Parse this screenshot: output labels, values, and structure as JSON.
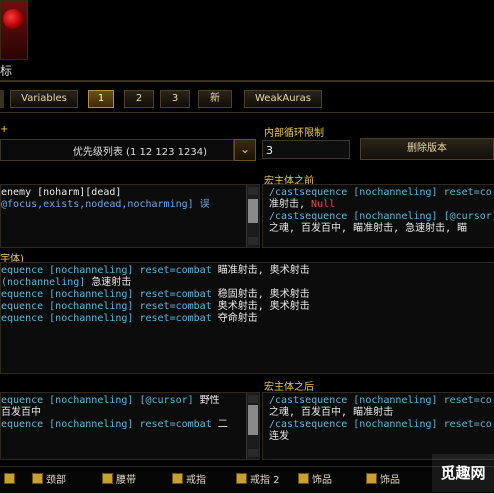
{
  "header": {
    "icon_label": "标"
  },
  "tabs": [
    "Variables",
    "1",
    "2",
    "3",
    "新",
    "WeakAuras"
  ],
  "active_tab": "1",
  "left_section_label": "",
  "priority_dropdown": {
    "value": "优先级列表 (1 12 123 1234)"
  },
  "inner_loop_label": "内部循环限制",
  "inner_loop_value": "3",
  "delete_button": "删除版本",
  "pre_macro_label": "宏主体之前",
  "top_left_lines": [
    {
      "parts": [
        {
          "t": "enemy [noharm][dead]",
          "c": "white"
        }
      ]
    },
    {
      "parts": [
        {
          "t": "@focus,exists,nodead,nocharming] 误",
          "c": "blue"
        }
      ]
    }
  ],
  "top_right_lines": [
    {
      "parts": [
        {
          "t": "/castsequence [nochanneling] reset=co",
          "c": "cyan"
        }
      ]
    },
    {
      "parts": [
        {
          "t": "准射击, ",
          "c": "white"
        },
        {
          "t": "Null",
          "c": "red"
        }
      ]
    },
    {
      "parts": [
        {
          "t": "/castsequence [nochanneling] [@cursor]",
          "c": "cyan"
        }
      ]
    },
    {
      "parts": [
        {
          "t": "之魂, 百发百中, 瞄准射击, 急速射击, 瞄",
          "c": "white"
        }
      ]
    }
  ],
  "body_label": "宇体)",
  "body_lines": [
    {
      "parts": [
        {
          "t": "equence [nochanneling] reset=combat ",
          "c": "cyan"
        },
        {
          "t": "瞄准射击, 奥术射击",
          "c": "white"
        }
      ]
    },
    {
      "parts": [
        {
          "t": "(nochanneling] ",
          "c": "cyan"
        },
        {
          "t": "急速射击",
          "c": "white"
        }
      ]
    },
    {
      "parts": [
        {
          "t": "equence [nochanneling] reset=combat ",
          "c": "cyan"
        },
        {
          "t": "稳固射击, 奥术射击",
          "c": "white"
        }
      ]
    },
    {
      "parts": [
        {
          "t": "equence [nochanneling] reset=combat ",
          "c": "cyan"
        },
        {
          "t": "奥术射击, 奥术射击",
          "c": "white"
        }
      ]
    },
    {
      "parts": [
        {
          "t": "equence [nochanneling] reset=combat ",
          "c": "cyan"
        },
        {
          "t": "夺命射击",
          "c": "white"
        }
      ]
    }
  ],
  "post_macro_label": "宏主体之后",
  "bottom_left_lines": [
    {
      "parts": [
        {
          "t": "equence [nochanneling] [@cursor] ",
          "c": "cyan"
        },
        {
          "t": "野性",
          "c": "white"
        }
      ]
    },
    {
      "parts": [
        {
          "t": "百发百中",
          "c": "white"
        }
      ]
    },
    {
      "parts": [
        {
          "t": "equence [nochanneling] reset=combat ",
          "c": "cyan"
        },
        {
          "t": "二",
          "c": "white"
        }
      ]
    }
  ],
  "bottom_right_lines": [
    {
      "parts": [
        {
          "t": "/castsequence [nochanneling] reset=co",
          "c": "cyan"
        }
      ]
    },
    {
      "parts": [
        {
          "t": "之魂, 百发百中, 瞄准射击",
          "c": "white"
        }
      ]
    },
    {
      "parts": [
        {
          "t": "/castsequence [nochanneling] reset=co",
          "c": "cyan"
        }
      ]
    },
    {
      "parts": [
        {
          "t": "连发",
          "c": "white"
        }
      ]
    }
  ],
  "bottom_slots": [
    "颈部",
    "腰带",
    "戒指",
    "戒指 2",
    "饰品",
    "饰品"
  ],
  "watermark": "觅趣网",
  "colors": {
    "gold": "#f2c84a",
    "cyan": "#5ab6d8",
    "blue": "#6aa6e8",
    "red": "#e84a4a",
    "white": "#e8e8e8"
  }
}
